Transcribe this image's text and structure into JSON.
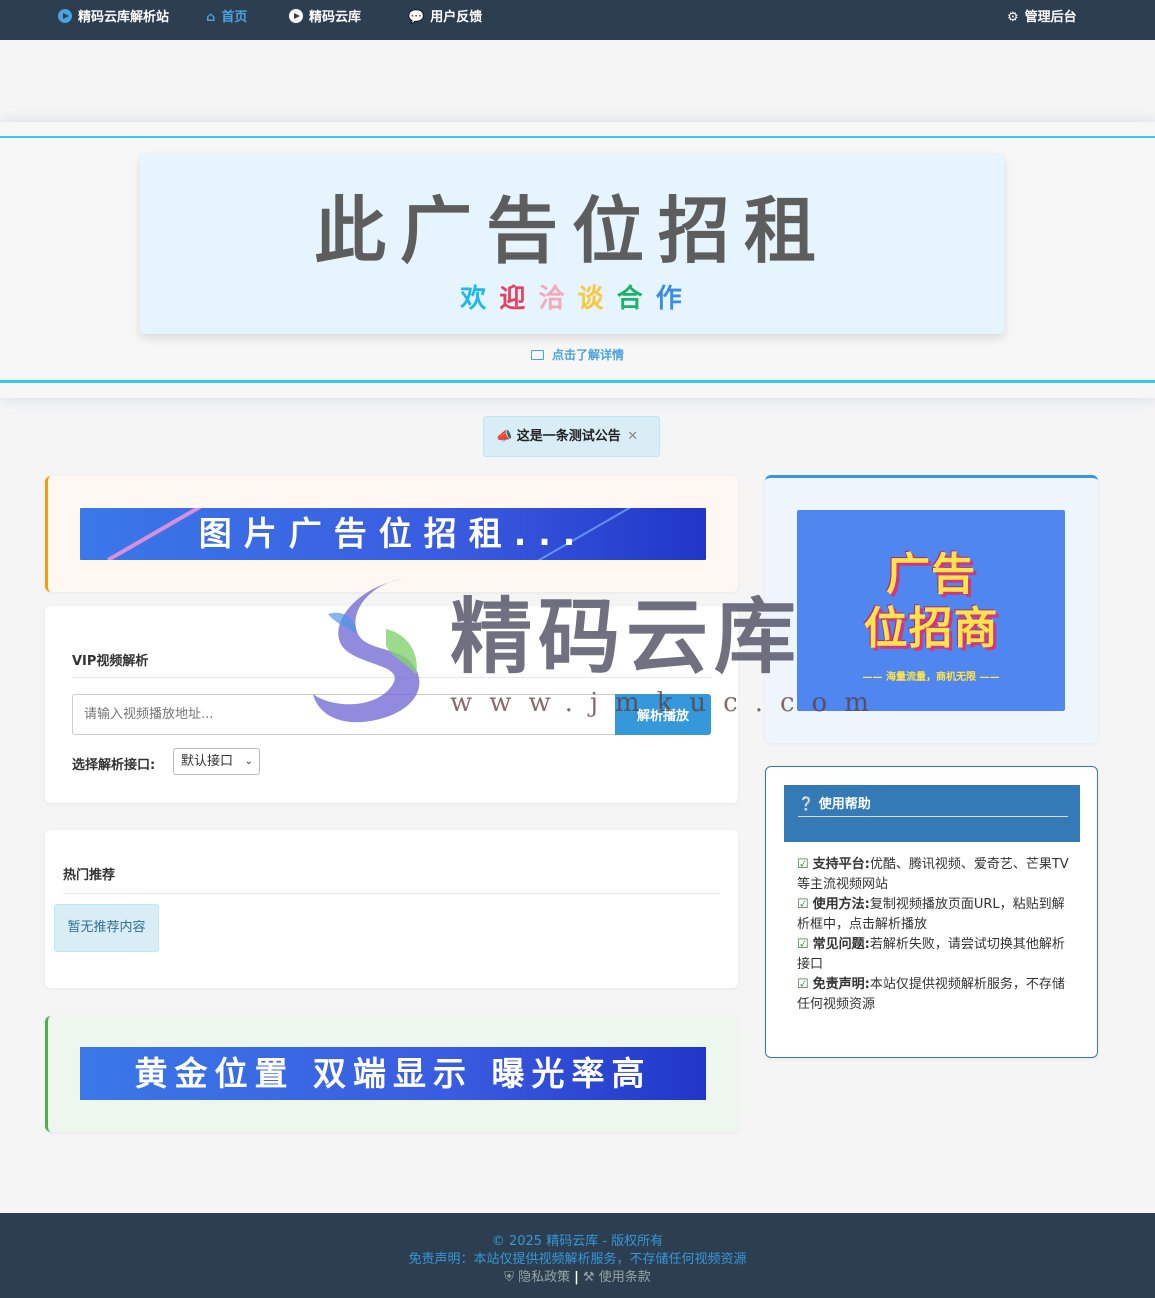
{
  "nav": {
    "brand": "精码云库解析站",
    "home": "首页",
    "cloud": "精码云库",
    "feedback": "用户反馈",
    "admin": "管理后台"
  },
  "top_ad": {
    "title": "此广告位招租",
    "subtitle_chars": [
      "欢",
      "迎",
      "洽",
      "谈",
      "合",
      "作"
    ],
    "subtitle_colors": [
      "#1fb8e8",
      "#e8405a",
      "#f7a8b8",
      "#f7c843",
      "#20b16a",
      "#3a8de0"
    ],
    "link": "点击了解详情"
  },
  "notice": {
    "text": "这是一条测试公告"
  },
  "image_ad": {
    "text": "图片广告位招租..."
  },
  "vip": {
    "heading": "VIP视频解析",
    "input_placeholder": "请输入视频播放地址...",
    "button": "解析播放",
    "api_label": "选择解析接口:",
    "api_selected": "默认接口"
  },
  "hot": {
    "heading": "热门推荐",
    "empty": "暂无推荐内容"
  },
  "gold_ad": {
    "text": "黄金位置 双端显示 曝光率高"
  },
  "side_ad": {
    "line1": "广告",
    "line2": "位招商",
    "tagline": "—— 海量流量，商机无限 ——"
  },
  "help": {
    "title": "使用帮助",
    "items": [
      {
        "label": "支持平台:",
        "text": "优酷、腾讯视频、爱奇艺、芒果TV等主流视频网站"
      },
      {
        "label": "使用方法:",
        "text": "复制视频播放页面URL，粘贴到解析框中，点击解析播放"
      },
      {
        "label": "常见问题:",
        "text": "若解析失败，请尝试切换其他解析接口"
      },
      {
        "label": "免责声明:",
        "text": "本站仅提供视频解析服务，不存储任何视频资源"
      }
    ]
  },
  "watermark": {
    "name": "精码云库",
    "url": "www.jmkuc.com"
  },
  "footer": {
    "copyright": "© 2025 精码云库 - 版权所有",
    "disclaimer": "免责声明：本站仅提供视频解析服务，不存储任何视频资源",
    "privacy": "隐私政策",
    "separator": "|",
    "terms": "使用条款"
  }
}
